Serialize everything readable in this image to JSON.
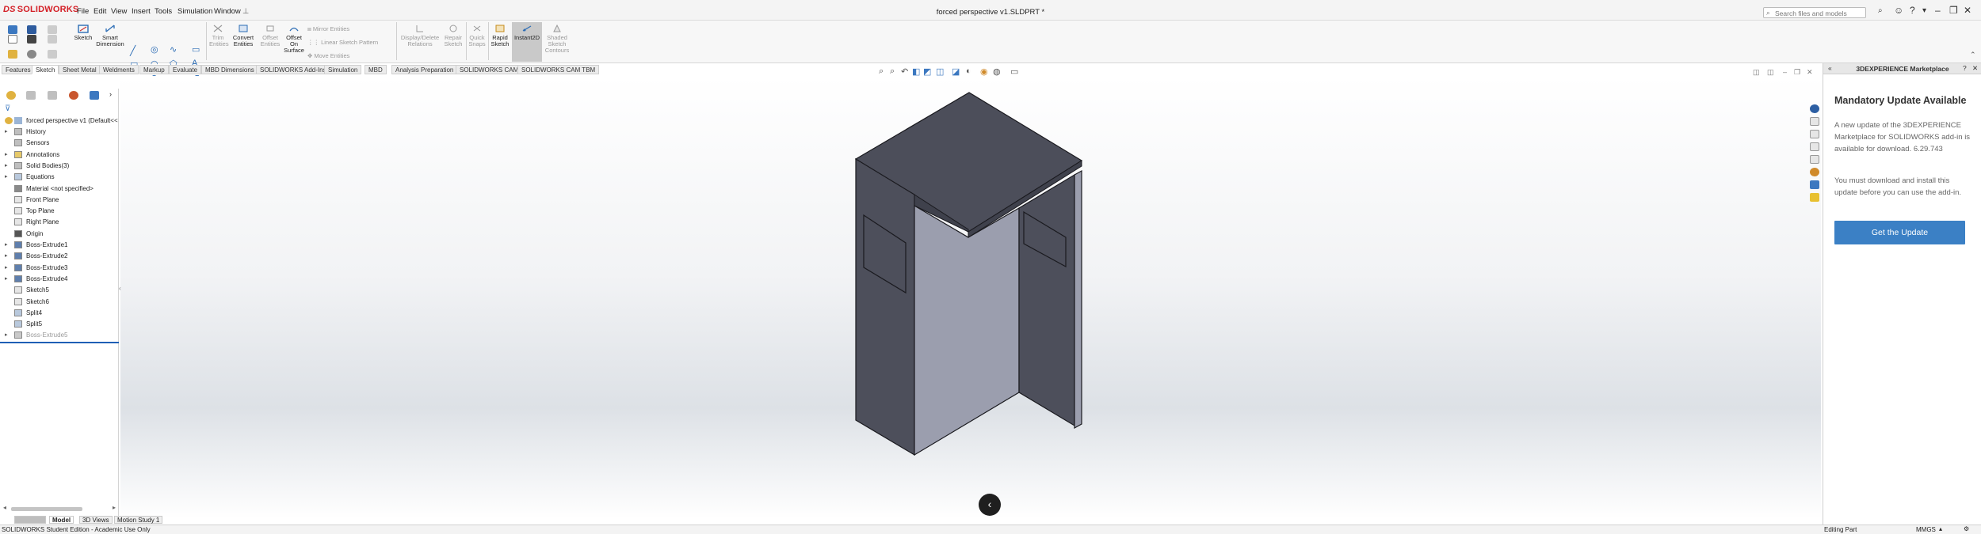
{
  "app": {
    "logo_brand": "DS",
    "logo_text": "SOLIDWORKS",
    "document_title": "forced perspective v1.SLDPRT *"
  },
  "menu": [
    "File",
    "Edit",
    "View",
    "Insert",
    "Tools",
    "Simulation",
    "Window"
  ],
  "search": {
    "placeholder": "Search files and models"
  },
  "ribbon": {
    "sketch": "Sketch",
    "smart_dimension": [
      "Smart",
      "Dimension"
    ],
    "trim": [
      "Trim",
      "Entities"
    ],
    "convert": [
      "Convert",
      "Entities"
    ],
    "offset": [
      "Offset",
      "Entities"
    ],
    "offset_surface": [
      "Offset",
      "On",
      "Surface"
    ],
    "mirror": "Mirror Entities",
    "linear_pattern": "Linear Sketch Pattern",
    "move": "Move Entities",
    "display_delete": [
      "Display/Delete",
      "Relations"
    ],
    "repair": [
      "Repair",
      "Sketch"
    ],
    "quick_snaps": [
      "Quick",
      "Snaps"
    ],
    "rapid_sketch": [
      "Rapid",
      "Sketch"
    ],
    "instant2d": "Instant2D",
    "shaded_contours": [
      "Shaded",
      "Sketch",
      "Contours"
    ]
  },
  "tabs": [
    "Features",
    "Sketch",
    "Sheet Metal",
    "Weldments",
    "Markup",
    "Evaluate",
    "MBD Dimensions",
    "SOLIDWORKS Add-Ins",
    "Simulation",
    "MBD",
    "Analysis Preparation",
    "SOLIDWORKS CAM",
    "SOLIDWORKS CAM TBM"
  ],
  "tree": {
    "root": "forced perspective v1  (Default<<",
    "items": [
      {
        "label": "History",
        "caret": "▸"
      },
      {
        "label": "Sensors",
        "caret": ""
      },
      {
        "label": "Annotations",
        "caret": "▸"
      },
      {
        "label": "Solid Bodies(3)",
        "caret": "▸"
      },
      {
        "label": "Equations",
        "caret": "▸"
      },
      {
        "label": "Material <not specified>",
        "caret": ""
      },
      {
        "label": "Front Plane",
        "caret": ""
      },
      {
        "label": "Top Plane",
        "caret": ""
      },
      {
        "label": "Right Plane",
        "caret": ""
      },
      {
        "label": "Origin",
        "caret": ""
      },
      {
        "label": "Boss-Extrude1",
        "caret": "▸"
      },
      {
        "label": "Boss-Extrude2",
        "caret": "▸"
      },
      {
        "label": "Boss-Extrude3",
        "caret": "▸"
      },
      {
        "label": "Boss-Extrude4",
        "caret": "▸"
      },
      {
        "label": "Sketch5",
        "caret": ""
      },
      {
        "label": "Sketch6",
        "caret": ""
      },
      {
        "label": "Split4",
        "caret": ""
      },
      {
        "label": "Split5",
        "caret": ""
      },
      {
        "label": "Boss-Extrude5",
        "caret": "▸"
      }
    ]
  },
  "bottom_tabs": [
    "Model",
    "3D Views",
    "Motion Study 1"
  ],
  "status": {
    "left": "SOLIDWORKS Student Edition - Academic Use Only",
    "mode": "Editing Part",
    "units": "MMGS"
  },
  "panel": {
    "header": "3DEXPERIENCE Marketplace",
    "title": "Mandatory Update Available",
    "text1": "A new update of the 3DEXPERIENCE Marketplace for SOLIDWORKS add-in is available for download. 6.29.743",
    "text2": "You must download and install this update before you can use the add-in.",
    "button": "Get the Update"
  },
  "colors": {
    "brand": "#d42027",
    "accent": "#3b80c5",
    "face_dark": "#4d4f5b",
    "face_light": "#9b9eae",
    "rollback": "#1f5fb5"
  }
}
